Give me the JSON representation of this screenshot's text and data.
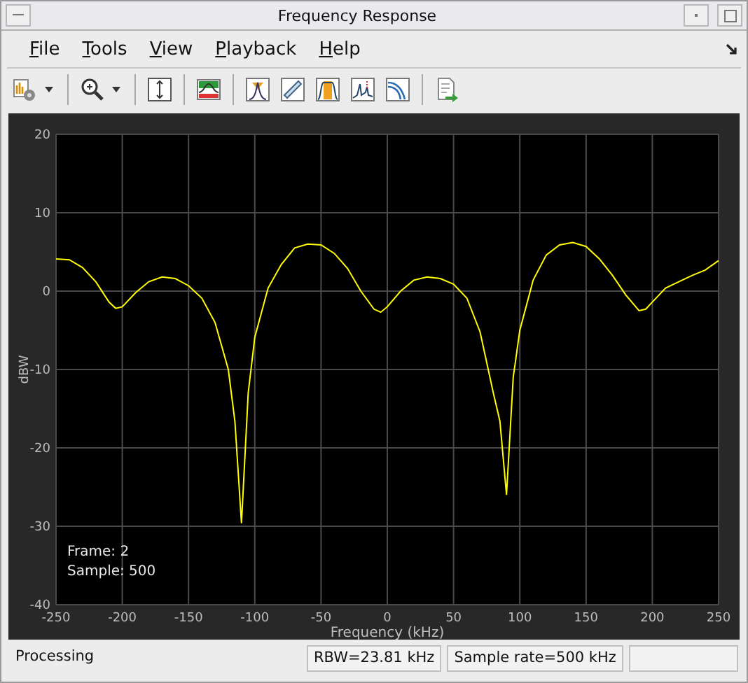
{
  "window": {
    "title": "Frequency Response"
  },
  "menu": [
    {
      "label": "File"
    },
    {
      "label": "Tools"
    },
    {
      "label": "View"
    },
    {
      "label": "Playback"
    },
    {
      "label": "Help"
    }
  ],
  "plot": {
    "overlay": [
      "Frame: 2",
      "Sample: 500"
    ],
    "chart_data": {
      "type": "line",
      "xlabel": "Frequency (kHz)",
      "ylabel": "dBW",
      "x": [
        -250,
        -240,
        -230,
        -220,
        -210,
        -205,
        -200,
        -190,
        -180,
        -170,
        -160,
        -150,
        -140,
        -130,
        -120,
        -115,
        -110,
        -105,
        -100,
        -90,
        -80,
        -70,
        -60,
        -50,
        -40,
        -30,
        -20,
        -10,
        -5,
        0,
        10,
        20,
        30,
        40,
        50,
        60,
        70,
        80,
        85,
        90,
        95,
        100,
        110,
        120,
        130,
        140,
        150,
        160,
        170,
        180,
        190,
        195,
        200,
        210,
        220,
        230,
        240,
        250
      ],
      "series": [
        {
          "color": "#ffff00",
          "values": [
            4.1,
            4,
            3,
            1.2,
            -1.4,
            -2.2,
            -2,
            -0.2,
            1.2,
            1.8,
            1.6,
            0.7,
            -0.9,
            -4,
            -10,
            -16.6,
            -29.6,
            -13,
            -5.9,
            0.4,
            3.4,
            5.5,
            6,
            5.9,
            4.8,
            2.9,
            0,
            -2.3,
            -2.7,
            -2,
            0,
            1.4,
            1.8,
            1.6,
            0.9,
            -0.9,
            -5.2,
            -13,
            -16.6,
            -26,
            -11,
            -5,
            1.4,
            4.6,
            5.9,
            6.2,
            5.7,
            4.1,
            2,
            -0.5,
            -2.5,
            -2.3,
            -1.4,
            0.4,
            1.2,
            2,
            2.7,
            3.9
          ]
        }
      ],
      "grid": true,
      "xlim": [
        -250,
        250
      ],
      "ylim": [
        -40,
        20
      ],
      "xticks": [
        -250,
        -200,
        -150,
        -100,
        -50,
        0,
        50,
        100,
        150,
        200,
        250
      ],
      "yticks": [
        -40,
        -30,
        -20,
        -10,
        0,
        10,
        20
      ]
    }
  },
  "status_bar": [
    "Processing",
    "RBW=23.81 kHz",
    "Sample rate=500 kHz"
  ]
}
